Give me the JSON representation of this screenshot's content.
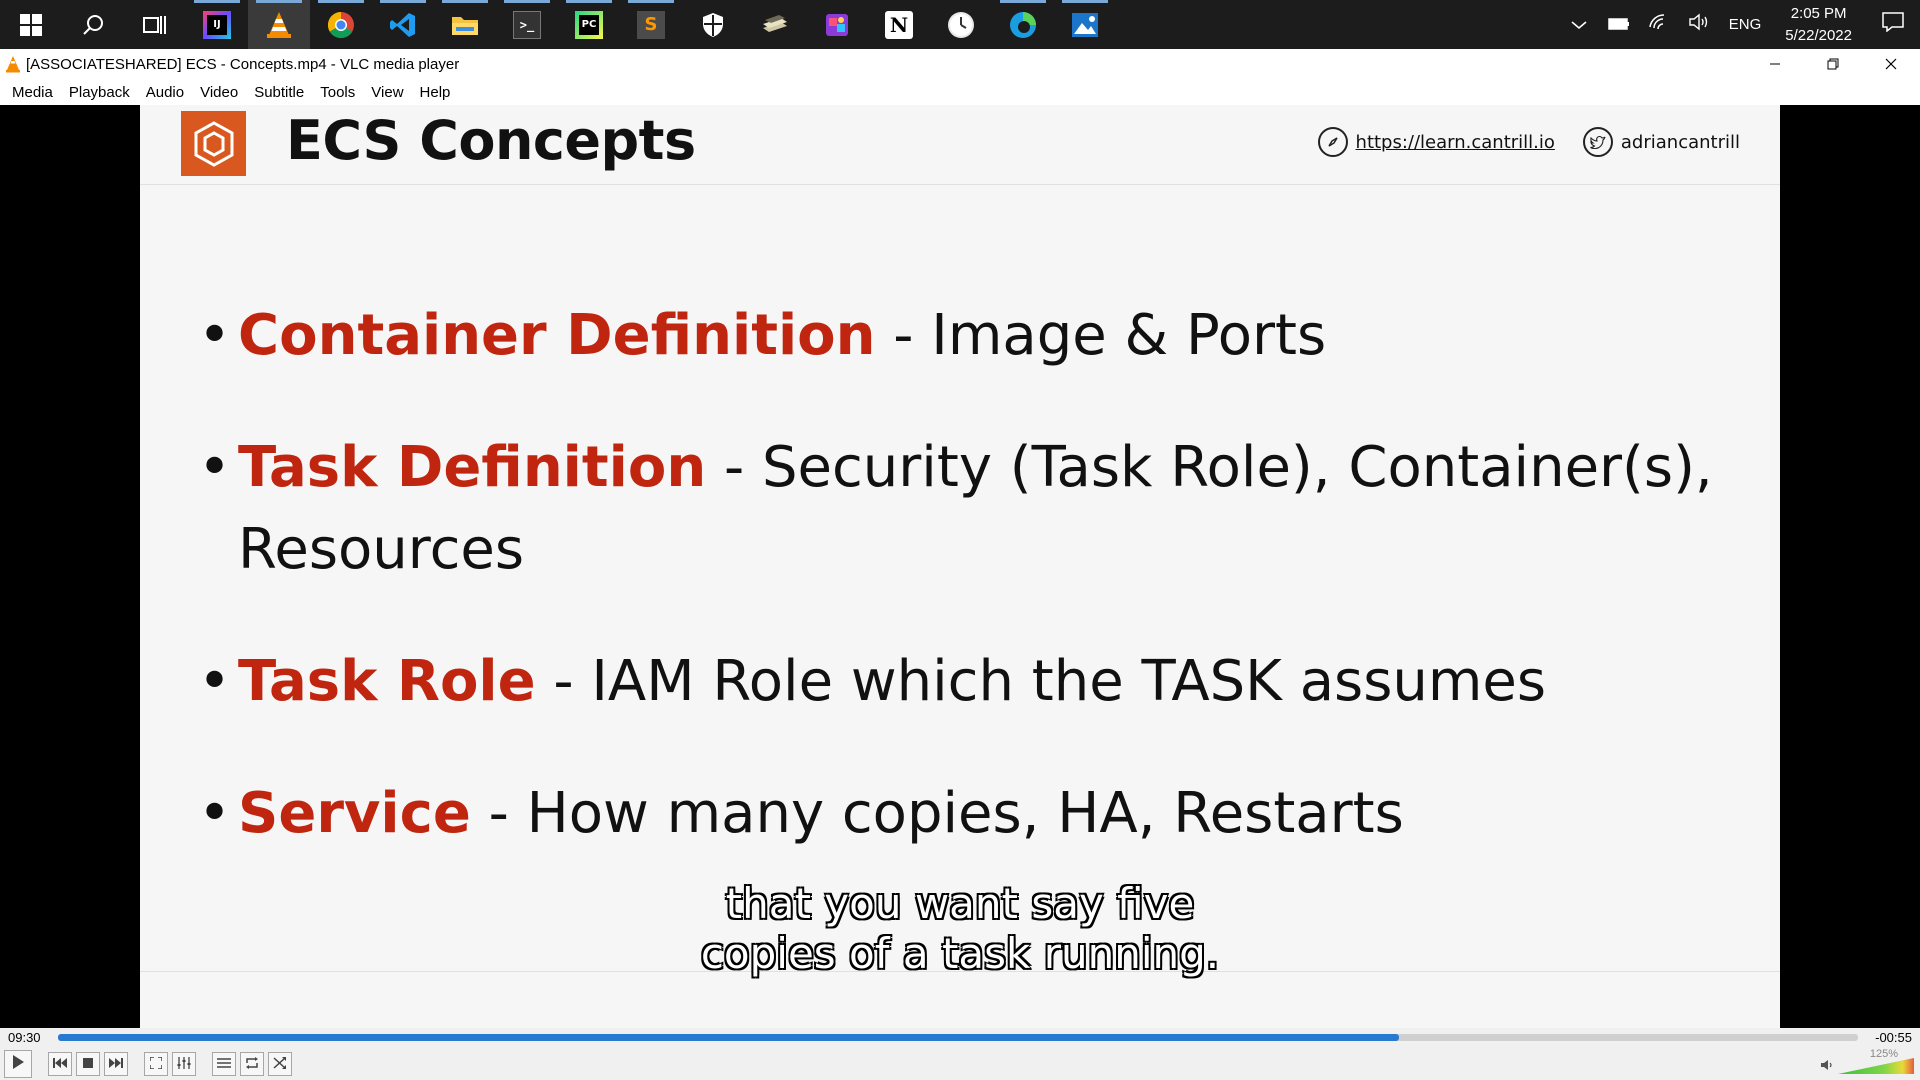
{
  "taskbar": {
    "apps": [
      {
        "name": "start-button",
        "glyph": ""
      },
      {
        "name": "search-button",
        "glyph": ""
      },
      {
        "name": "task-view-button",
        "glyph": ""
      },
      {
        "name": "intellij-app",
        "glyph": "IJ"
      },
      {
        "name": "vlc-app",
        "glyph": ""
      },
      {
        "name": "chrome-app",
        "glyph": ""
      },
      {
        "name": "vscode-app",
        "glyph": ""
      },
      {
        "name": "file-explorer-app",
        "glyph": ""
      },
      {
        "name": "terminal-app",
        "glyph": ">_"
      },
      {
        "name": "pycharm-app",
        "glyph": "PC"
      },
      {
        "name": "sublime-app",
        "glyph": "S"
      },
      {
        "name": "security-app",
        "glyph": ""
      },
      {
        "name": "stack-app",
        "glyph": ""
      },
      {
        "name": "photo-app",
        "glyph": ""
      },
      {
        "name": "notion-app",
        "glyph": "N"
      },
      {
        "name": "clock-app",
        "glyph": ""
      },
      {
        "name": "edge-app",
        "glyph": ""
      },
      {
        "name": "photos-app",
        "glyph": ""
      }
    ],
    "language": "ENG",
    "time": "2:05 PM",
    "date": "5/22/2022"
  },
  "window": {
    "title": "[ASSOCIATESHARED] ECS - Concepts.mp4 - VLC media player"
  },
  "menu": {
    "items": [
      "Media",
      "Playback",
      "Audio",
      "Video",
      "Subtitle",
      "Tools",
      "View",
      "Help"
    ]
  },
  "slide": {
    "title": "ECS Concepts",
    "site_link": "https://learn.cantrill.io",
    "twitter_handle": "adriancantrill",
    "bullets": [
      {
        "term": "Container Definition",
        "desc": " - Image & Ports"
      },
      {
        "term": "Task Definition",
        "desc": " - Security (Task Role), Container(s), Resources"
      },
      {
        "term": "Task Role",
        "desc": " - IAM Role which the TASK assumes"
      },
      {
        "term": "Service",
        "desc": " - How many copies, HA, Restarts"
      }
    ]
  },
  "subtitle": {
    "line1": "that you want say five",
    "line2": "copies of a task running."
  },
  "player": {
    "time_elapsed": "09:30",
    "time_remaining": "-00:55",
    "progress_fraction": 0.745,
    "volume": "125%",
    "accent_color": "#2879d0"
  }
}
